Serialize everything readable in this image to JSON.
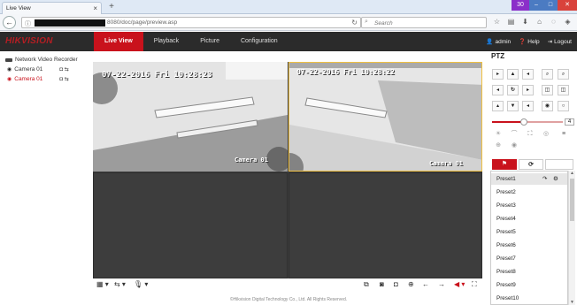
{
  "browser": {
    "tab_title": "Live View",
    "tab_close": "×",
    "new_tab": "+",
    "url_suffix": "8080/doc/page/preview.asp",
    "search_placeholder": "Search",
    "window_badge": "30"
  },
  "app": {
    "logo": "HIKVISION",
    "menu": [
      "Live View",
      "Playback",
      "Picture",
      "Configuration"
    ],
    "user": "admin",
    "help": "Help",
    "logout": "Logout"
  },
  "tree": {
    "root": "Network Video Recorder",
    "cameras": [
      {
        "label": "Camera 01",
        "color": "#333333"
      },
      {
        "label": "Camera 01",
        "color": "#c9121c"
      }
    ]
  },
  "video": {
    "cells": [
      {
        "time": "07-22-2016 Fri 10:28:23",
        "name": "Camera 01"
      },
      {
        "time": "07-22-2016 Fri 10:28:22",
        "name": "Camera 01"
      }
    ]
  },
  "ptz": {
    "title": "PTZ",
    "speed": "4",
    "presets": [
      "Preset1",
      "Preset2",
      "Preset3",
      "Preset4",
      "Preset5",
      "Preset6",
      "Preset7",
      "Preset8",
      "Preset9",
      "Preset10"
    ]
  },
  "footer": "©Hikvision Digital Technology Co., Ltd. All Rights Reserved.",
  "colors": {
    "accent": "#c9121c",
    "header": "#2b2b2b",
    "selected_camera": "#c9121c"
  }
}
